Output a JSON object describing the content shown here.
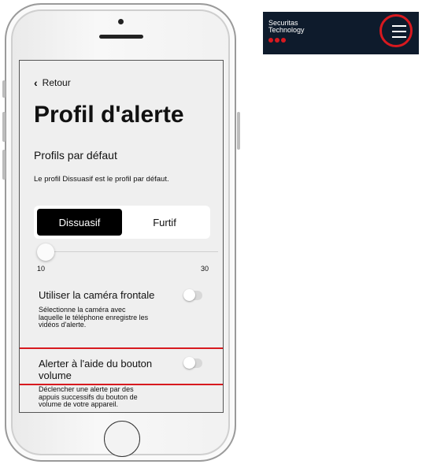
{
  "app": {
    "back_label": "Retour",
    "title": "Profil d'alerte",
    "section_title": "Profils par défaut",
    "section_description": "Le profil Dissuasif est le profil par défaut.",
    "profiles": [
      {
        "label": "Dissuasif",
        "selected": true
      },
      {
        "label": "Furtif",
        "selected": false
      }
    ],
    "slider": {
      "value_label": "10",
      "min_label": "10",
      "max_label": "30"
    },
    "settings": [
      {
        "title": "Utiliser la caméra frontale",
        "description_lines": [
          "Sélectionne la caméra avec",
          "laquelle le téléphone enregistre les",
          "vidéos d'alerte."
        ],
        "enabled": false
      },
      {
        "title_lines": [
          "Alerter à l'aide du bouton",
          "volume"
        ],
        "description_lines": [
          "Déclencher une alerte par des",
          "appuis successifs du bouton de",
          "volume de votre appareil."
        ],
        "enabled": false
      }
    ]
  },
  "brand": {
    "name_line1": "Securitas",
    "name_line2": "Technology",
    "menu_icon": "hamburger-menu-icon"
  },
  "colors": {
    "accent_red": "#d7191f",
    "brand_navy": "#0e1b2c",
    "screen_bg": "#efefef",
    "selected_segment": "#000000"
  }
}
